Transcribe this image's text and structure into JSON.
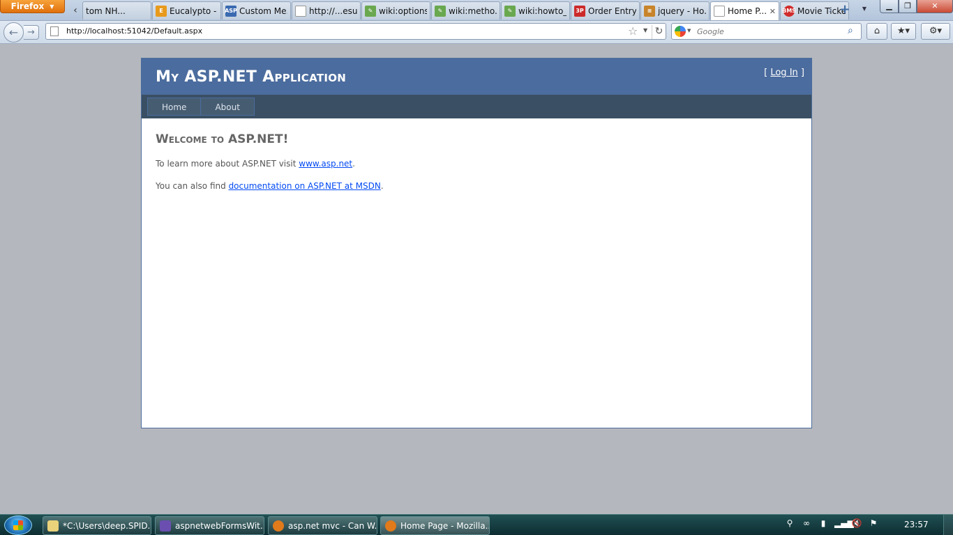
{
  "browser": {
    "menu_button": "Firefox",
    "tabs": [
      {
        "title": "tom NH...",
        "icon": "generic"
      },
      {
        "title": "Eucalypto - ...",
        "icon": "eucalypto",
        "color": "#e89a1c"
      },
      {
        "title": "Custom Me...",
        "icon": "asp",
        "color": "#3a6ab0"
      },
      {
        "title": "http://...esults",
        "icon": "page"
      },
      {
        "title": "wiki:options...",
        "icon": "wiki",
        "color": "#6aa84f"
      },
      {
        "title": "wiki:metho...",
        "icon": "wiki",
        "color": "#6aa84f"
      },
      {
        "title": "wiki:howto_...",
        "icon": "wiki",
        "color": "#6aa84f"
      },
      {
        "title": "Order Entry",
        "icon": "order",
        "color": "#cc2a2a"
      },
      {
        "title": "jquery - Ho...",
        "icon": "stackoverflow",
        "color": "#c8842a"
      },
      {
        "title": "Home P...",
        "icon": "page",
        "active": true
      },
      {
        "title": "Movie Ticke...",
        "icon": "bms",
        "color": "#d12b2b"
      }
    ],
    "url": "http://localhost:51042/Default.aspx",
    "search_placeholder": "Google"
  },
  "site": {
    "title": "My ASP.NET Application",
    "login_prefix": "[ ",
    "login_link": "Log In",
    "login_suffix": " ]",
    "menu": [
      "Home",
      "About"
    ],
    "heading": "Welcome to ASP.NET!",
    "para1_text": "To learn more about ASP.NET visit ",
    "para1_link": "www.asp.net",
    "para1_end": ".",
    "para2_text": "You can also find ",
    "para2_link": "documentation on ASP.NET at MSDN",
    "para2_end": ".",
    "colors": {
      "header": "#4b6c9e",
      "menu_bar": "#3a4f63",
      "link": "#034af3"
    }
  },
  "taskbar": {
    "tasks": [
      {
        "label": "*C:\\Users\\deep.SPID...",
        "color": "#e9d27a"
      },
      {
        "label": "aspnetwebFormsWit...",
        "color": "#6a4fb0"
      },
      {
        "label": "asp.net mvc - Can W...",
        "color": "#e07a1a"
      },
      {
        "label": "Home Page - Mozilla...",
        "color": "#e07a1a",
        "active": true
      }
    ],
    "clock": "23:57"
  }
}
